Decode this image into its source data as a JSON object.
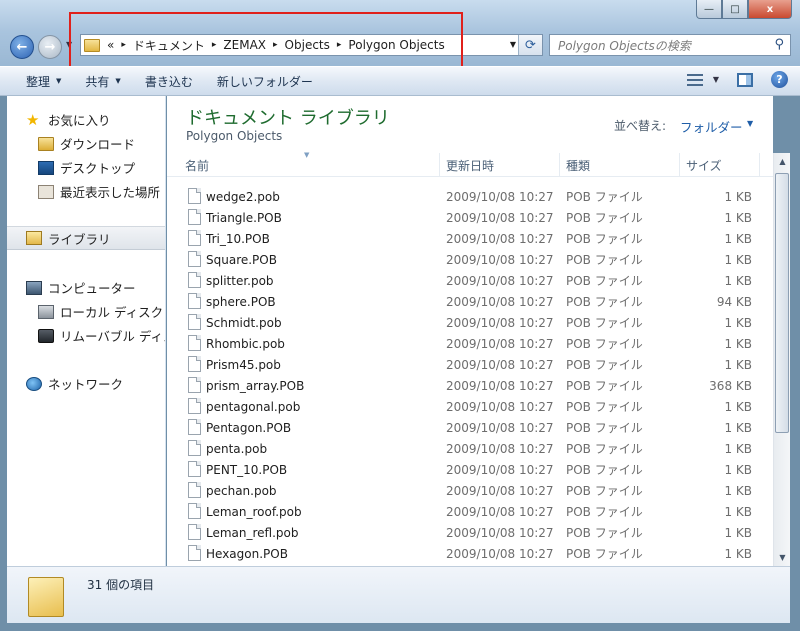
{
  "window_controls": {
    "minimize": "—",
    "maximize": "□",
    "close": "x"
  },
  "address": {
    "overflow": "«",
    "crumbs": [
      "ドキュメント",
      "ZEMAX",
      "Objects",
      "Polygon Objects"
    ],
    "separator": "▸"
  },
  "search": {
    "placeholder": "Polygon Objectsの検索"
  },
  "toolbar": {
    "organize": "整理",
    "share": "共有",
    "burn": "書き込む",
    "new_folder": "新しいフォルダー"
  },
  "navpane": {
    "favorites": "お気に入り",
    "downloads": "ダウンロード",
    "desktop": "デスクトップ",
    "recent": "最近表示した場所",
    "libraries": "ライブラリ",
    "computer": "コンピューター",
    "local_disk": "ローカル ディスク",
    "removable": "リムーバブル ディス",
    "network": "ネットワーク"
  },
  "library": {
    "title": "ドキュメント ライブラリ",
    "subtitle": "Polygon Objects",
    "sort_label": "並べ替え:",
    "sort_value": "フォルダー"
  },
  "columns": {
    "name": "名前",
    "date": "更新日時",
    "type": "種類",
    "size": "サイズ"
  },
  "files": [
    {
      "name": "wedge2.pob",
      "date": "2009/10/08 10:27",
      "type": "POB ファイル",
      "size": "1 KB"
    },
    {
      "name": "Triangle.POB",
      "date": "2009/10/08 10:27",
      "type": "POB ファイル",
      "size": "1 KB"
    },
    {
      "name": "Tri_10.POB",
      "date": "2009/10/08 10:27",
      "type": "POB ファイル",
      "size": "1 KB"
    },
    {
      "name": "Square.POB",
      "date": "2009/10/08 10:27",
      "type": "POB ファイル",
      "size": "1 KB"
    },
    {
      "name": "splitter.pob",
      "date": "2009/10/08 10:27",
      "type": "POB ファイル",
      "size": "1 KB"
    },
    {
      "name": "sphere.POB",
      "date": "2009/10/08 10:27",
      "type": "POB ファイル",
      "size": "94 KB"
    },
    {
      "name": "Schmidt.pob",
      "date": "2009/10/08 10:27",
      "type": "POB ファイル",
      "size": "1 KB"
    },
    {
      "name": "Rhombic.pob",
      "date": "2009/10/08 10:27",
      "type": "POB ファイル",
      "size": "1 KB"
    },
    {
      "name": "Prism45.pob",
      "date": "2009/10/08 10:27",
      "type": "POB ファイル",
      "size": "1 KB"
    },
    {
      "name": "prism_array.POB",
      "date": "2009/10/08 10:27",
      "type": "POB ファイル",
      "size": "368 KB"
    },
    {
      "name": "pentagonal.pob",
      "date": "2009/10/08 10:27",
      "type": "POB ファイル",
      "size": "1 KB"
    },
    {
      "name": "Pentagon.POB",
      "date": "2009/10/08 10:27",
      "type": "POB ファイル",
      "size": "1 KB"
    },
    {
      "name": "penta.pob",
      "date": "2009/10/08 10:27",
      "type": "POB ファイル",
      "size": "1 KB"
    },
    {
      "name": "PENT_10.POB",
      "date": "2009/10/08 10:27",
      "type": "POB ファイル",
      "size": "1 KB"
    },
    {
      "name": "pechan.pob",
      "date": "2009/10/08 10:27",
      "type": "POB ファイル",
      "size": "1 KB"
    },
    {
      "name": "Leman_roof.pob",
      "date": "2009/10/08 10:27",
      "type": "POB ファイル",
      "size": "1 KB"
    },
    {
      "name": "Leman_refl.pob",
      "date": "2009/10/08 10:27",
      "type": "POB ファイル",
      "size": "1 KB"
    },
    {
      "name": "Hexagon.POB",
      "date": "2009/10/08 10:27",
      "type": "POB ファイル",
      "size": "1 KB"
    }
  ],
  "details": {
    "item_count": "31 個の項目"
  },
  "icons": {
    "back": "arrow-left-icon",
    "forward": "arrow-right-icon",
    "refresh": "refresh-icon",
    "search": "search-icon",
    "help": "help-icon"
  },
  "colors": {
    "library_title": "#1e6b2e",
    "sort_link": "#1f5ea8",
    "highlight": "#e0201b"
  }
}
